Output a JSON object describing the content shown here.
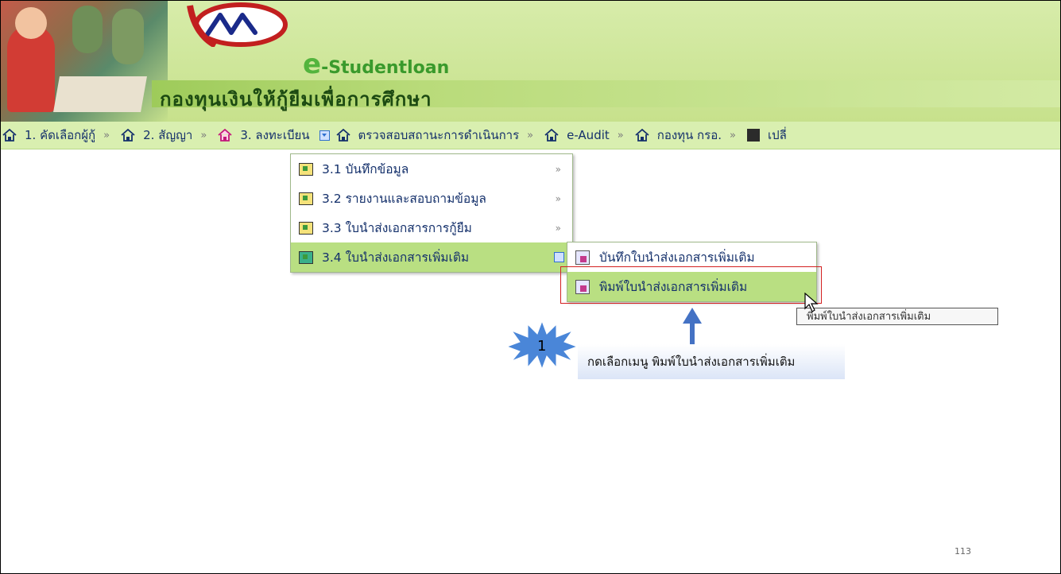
{
  "header": {
    "brand_e": "e",
    "brand_text": "-Studentloan",
    "org_name": "กองทุนเงินให้กู้ยืมเพื่อการศึกษา"
  },
  "nav": {
    "items": [
      {
        "label": "1. คัดเลือกผู้กู้"
      },
      {
        "label": "2. สัญญา"
      },
      {
        "label": "3. ลงทะเบียน"
      },
      {
        "label": "ตรวจสอบสถานะการดำเนินการ"
      },
      {
        "label": "e-Audit"
      },
      {
        "label": "กองทุน กรอ."
      },
      {
        "label": "เปลี่"
      }
    ],
    "separator": "»"
  },
  "menu": {
    "items": [
      {
        "label": "3.1 บันทึกข้อมูล"
      },
      {
        "label": "3.2 รายงานและสอบถามข้อมูล"
      },
      {
        "label": "3.3 ใบนำส่งเอกสารการกู้ยืม"
      },
      {
        "label": "3.4 ใบนำส่งเอกสารเพิ่มเติม"
      }
    ],
    "arrow": "»"
  },
  "submenu": {
    "items": [
      {
        "label": "บันทึกใบนำส่งเอกสารเพิ่มเติม"
      },
      {
        "label": "พิมพ์ใบนำส่งเอกสารเพิ่มเติม"
      }
    ]
  },
  "tooltip": "พิมพ์ใบนำส่งเอกสารเพิ่มเติม",
  "annotation": {
    "step": "1",
    "text": "กดเลือกเมนู พิมพ์ใบนำส่งเอกสารเพิ่มเติม"
  },
  "page_number": "113",
  "colors": {
    "banner": "#c7e18c",
    "navbar": "#d9efb0",
    "selected": "#b9df82",
    "highlight_box": "#d32020",
    "arrow": "#4472c4",
    "burst": "#4a86d8"
  }
}
